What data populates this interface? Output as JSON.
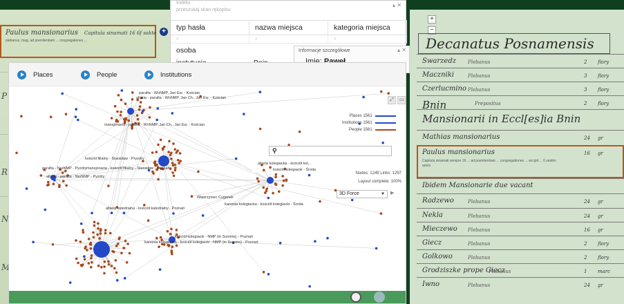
{
  "left_scan": {
    "highlight_line": "Paulus mansionarius",
    "highlight_note": "Capitula sinamati 16 6f sakte",
    "highlight_subnote": "plebanus, mag. ad poenitentiam ... congregationes ...",
    "side_marks": [
      "P",
      "R",
      "Nc",
      "M"
    ]
  },
  "index": {
    "faded_header": "Indeks",
    "faded_subheader": "przeszukaj skan rękopisu",
    "columns": [
      "typ hasła",
      "nazwa miejsca",
      "kategoria miejsca"
    ],
    "rows": [
      {
        "type": "osoba",
        "place": "",
        "category": ""
      },
      {
        "type": "instytucja",
        "place": "Bnin",
        "category": ""
      }
    ]
  },
  "details": {
    "title": "Informacje szczegółowe",
    "name_label": "Imię:",
    "name_value": "Paweł"
  },
  "graph": {
    "tabs": [
      "Places",
      "People",
      "Institutions"
    ],
    "legend": [
      {
        "label": "Places 1561",
        "color": "#2448c8"
      },
      {
        "label": "Institutions 1561",
        "color": "#2448c8"
      },
      {
        "label": "People 1561",
        "color": "#a8481a"
      }
    ],
    "search_placeholder": "",
    "nodes_stat": "Nodes: 1249 Links: 1297",
    "layout_stat": "Layout complete: 100%",
    "layout_option": "3D Force",
    "node_labels": [
      "parafia - WnNMP, Jan Ew. - Kościan",
      "altaria - parafia - WnNMP, Jan Ch., Jan Ew. - Kościan",
      "mansjonaria - parafia - WnNMP, Jan Ch., Jan Ew. - Kościan",
      "kościół filialny - Stanisław - Pryzdry",
      "parafia - NarNMP - Pyzdry",
      "altaria - parafia - NarNMP - Pyzdry",
      "mansjonaria - kościół filialny - Stanisław - Poznań",
      "altaria kolegiacka - kościół kol...",
      "kościół kolegiacki - Środa",
      "altaria katedralna - kościół katedralny - Poznań",
      "Wawrzyniec Cyganek",
      "kanonia kolegiacka - kościół kolegiacki - Środa",
      "kościół kolegiacki - NMP (in Summo) - Poznań",
      "kanonia kolegiacka - kościół kolegiacki - NMP (in Summo) - Poznań"
    ]
  },
  "register": {
    "title": "Decanatus Posnamensis",
    "rows": [
      {
        "name": "Swarzedz",
        "rank": "Plebanus",
        "num": "2",
        "unit": "flory"
      },
      {
        "name": "Maczniki",
        "rank": "Plebanus",
        "num": "3",
        "unit": "flory"
      },
      {
        "name": "Czerlucmino",
        "rank": "Plebanus",
        "num": "3",
        "unit": "flory"
      },
      {
        "name": "Bnin",
        "rank": "Prepositus",
        "num": "2",
        "unit": "flory"
      },
      {
        "name": "Mansionarii in Eccl[es]ia Bnin",
        "rank": "",
        "num": "",
        "unit": ""
      },
      {
        "name": "Mathias mansionarius",
        "rank": "",
        "num": "24",
        "unit": "gr"
      },
      {
        "name": "Paulus mansionarius",
        "rank": "",
        "num": "16",
        "unit": "gr"
      },
      {
        "name": "Ibidem Mansionarie due vacant",
        "rank": "",
        "num": "",
        "unit": ""
      },
      {
        "name": "Radzewo",
        "rank": "Plebanus",
        "num": "24",
        "unit": "gr"
      },
      {
        "name": "Nekla",
        "rank": "Plebanus",
        "num": "24",
        "unit": "gr"
      },
      {
        "name": "Mieczewo",
        "rank": "Plebanus",
        "num": "16",
        "unit": "gr"
      },
      {
        "name": "Giecz",
        "rank": "Plebanus",
        "num": "2",
        "unit": "flory"
      },
      {
        "name": "Golkowo",
        "rank": "Plebanus",
        "num": "2",
        "unit": "flory"
      },
      {
        "name": "Grodziszke prope Giecz",
        "rank": "Plebanus",
        "num": "1",
        "unit": "marc"
      },
      {
        "name": "Iwno",
        "rank": "Plebanus",
        "num": "24",
        "unit": "gr"
      }
    ],
    "highlight_note": "Capitula sinamati sempre 16 ... ad poenitentiam ... congregationes ... accipit ... 6 vestim annis"
  }
}
